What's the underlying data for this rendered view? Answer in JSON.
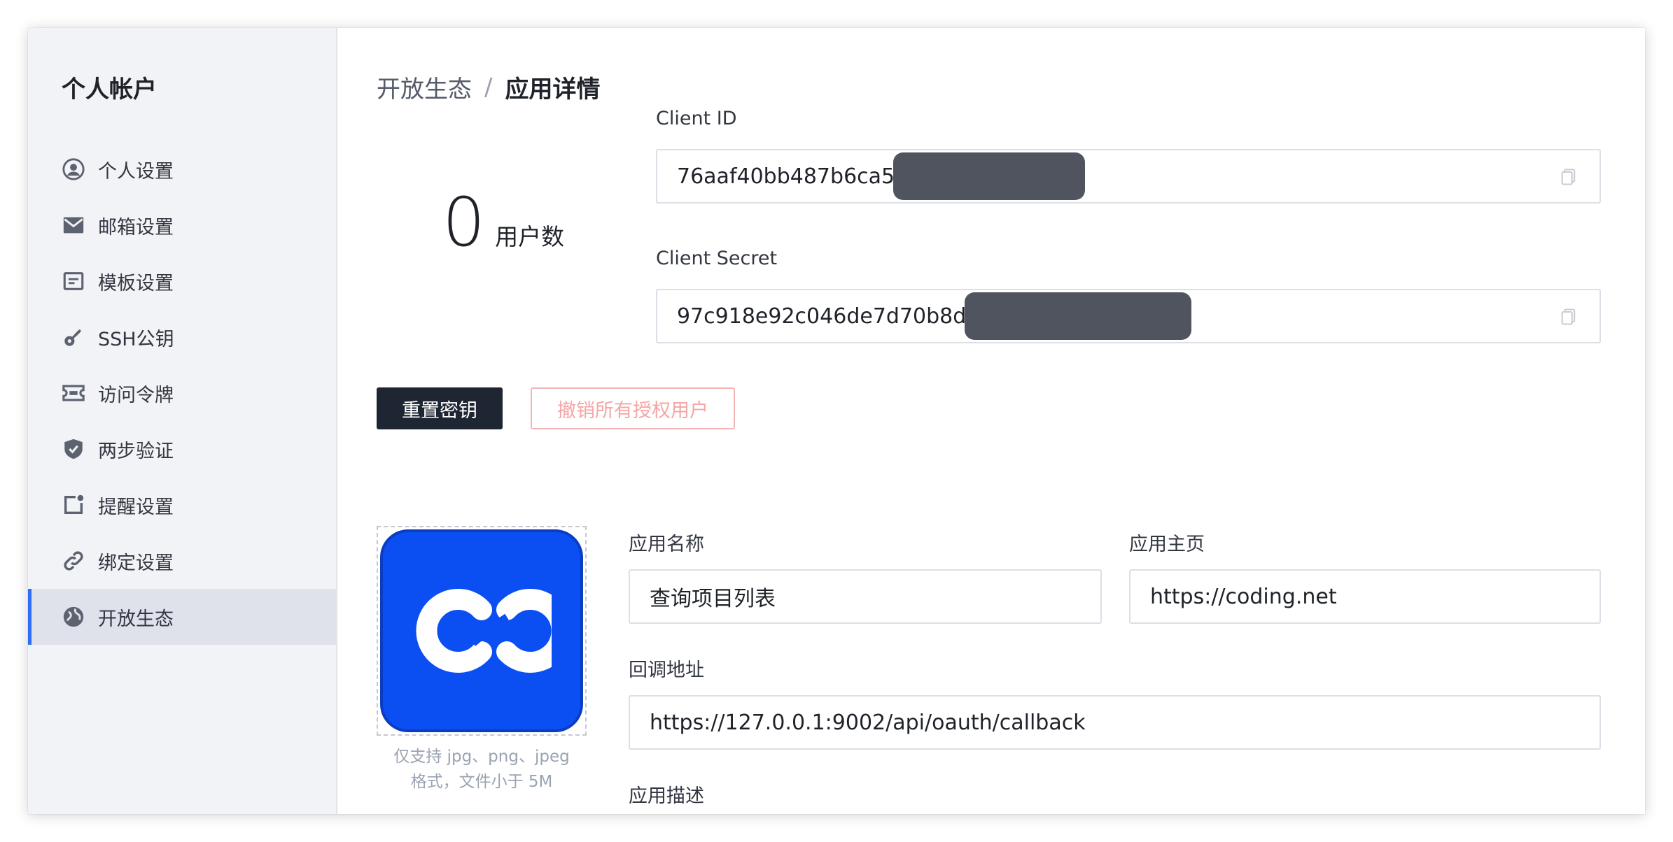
{
  "sidebar": {
    "title": "个人帐户",
    "items": [
      {
        "label": "个人设置",
        "icon": "user-circle-icon"
      },
      {
        "label": "邮箱设置",
        "icon": "mail-icon"
      },
      {
        "label": "模板设置",
        "icon": "template-icon"
      },
      {
        "label": "SSH公钥",
        "icon": "key-icon"
      },
      {
        "label": "访问令牌",
        "icon": "ticket-icon"
      },
      {
        "label": "两步验证",
        "icon": "shield-icon"
      },
      {
        "label": "提醒设置",
        "icon": "notification-icon"
      },
      {
        "label": "绑定设置",
        "icon": "link-icon"
      },
      {
        "label": "开放生态",
        "icon": "globe-icon",
        "active": true
      }
    ]
  },
  "breadcrumb": {
    "parent": "开放生态",
    "separator": "/",
    "current": "应用详情"
  },
  "stats": {
    "user_count": "0",
    "user_count_label": "用户数"
  },
  "credentials": {
    "client_id_label": "Client ID",
    "client_id_visible": "76aaf40bb487b6ca5",
    "client_secret_label": "Client Secret",
    "client_secret_visible": "97c918e92c046de7d70b8d"
  },
  "actions": {
    "reset_key": "重置密钥",
    "revoke_all": "撤销所有授权用户"
  },
  "app_form": {
    "logo_hint_line1": "仅支持 jpg、png、jpeg",
    "logo_hint_line2": "格式，文件小于 5M",
    "name_label": "应用名称",
    "name_value": "查询项目列表",
    "homepage_label": "应用主页",
    "homepage_value": "https://coding.net",
    "callback_label": "回调地址",
    "callback_value": "https://127.0.0.1:9002/api/oauth/callback",
    "description_label": "应用描述"
  },
  "colors": {
    "accent": "#2d6cf7",
    "logo_blue": "#0b4ff3",
    "dark_button": "#1f2633",
    "danger_outline": "#f5b5b5",
    "mask": "#50545e"
  }
}
